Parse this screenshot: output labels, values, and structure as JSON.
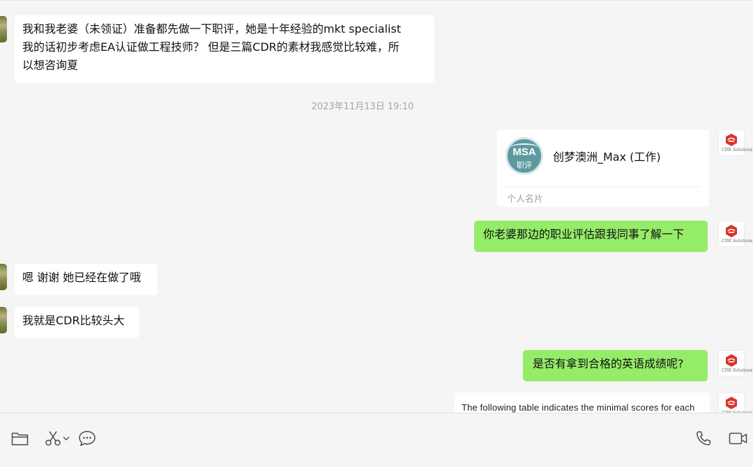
{
  "messages": [
    {
      "side": "left",
      "text_lines": [
        "我和我老婆（未领证）准备都先做一下职评，她是十年经验的mkt specialist",
        "我的话初步考虑EA认证做工程技师？ 但是三篇CDR的素材我感觉比较难，所",
        "以想咨询夏"
      ]
    },
    {
      "side": "right",
      "text": "你老婆那边的职业评估跟我同事了解一下"
    },
    {
      "side": "left",
      "text": "嗯 谢谢 她已经在做了哦"
    },
    {
      "side": "left",
      "text": "我就是CDR比较头大"
    },
    {
      "side": "right",
      "text": "是否有拿到合格的英语成绩呢?"
    }
  ],
  "timestamp": "2023年11月13日 19:10",
  "contact_card": {
    "logo_text": "MSA",
    "logo_subtext": "职评",
    "name": "创梦澳洲_Max (工作)",
    "label": "个人名片"
  },
  "doc_preview": {
    "text": "The following table indicates the minimal scores for each"
  },
  "right_avatar_sig": "CDR Solutions",
  "colors": {
    "background": "#f5f5f5",
    "bubble_left": "#ffffff",
    "bubble_right": "#95ec69",
    "timestamp": "#a6a6a6",
    "icon_gray": "#4a4a4a",
    "logo_red": "#d9332c"
  },
  "toolbar": {
    "icons": [
      "folder-icon",
      "scissors-icon",
      "chevron-down-icon",
      "chat-bubble-icon",
      "phone-icon",
      "video-call-icon"
    ]
  }
}
